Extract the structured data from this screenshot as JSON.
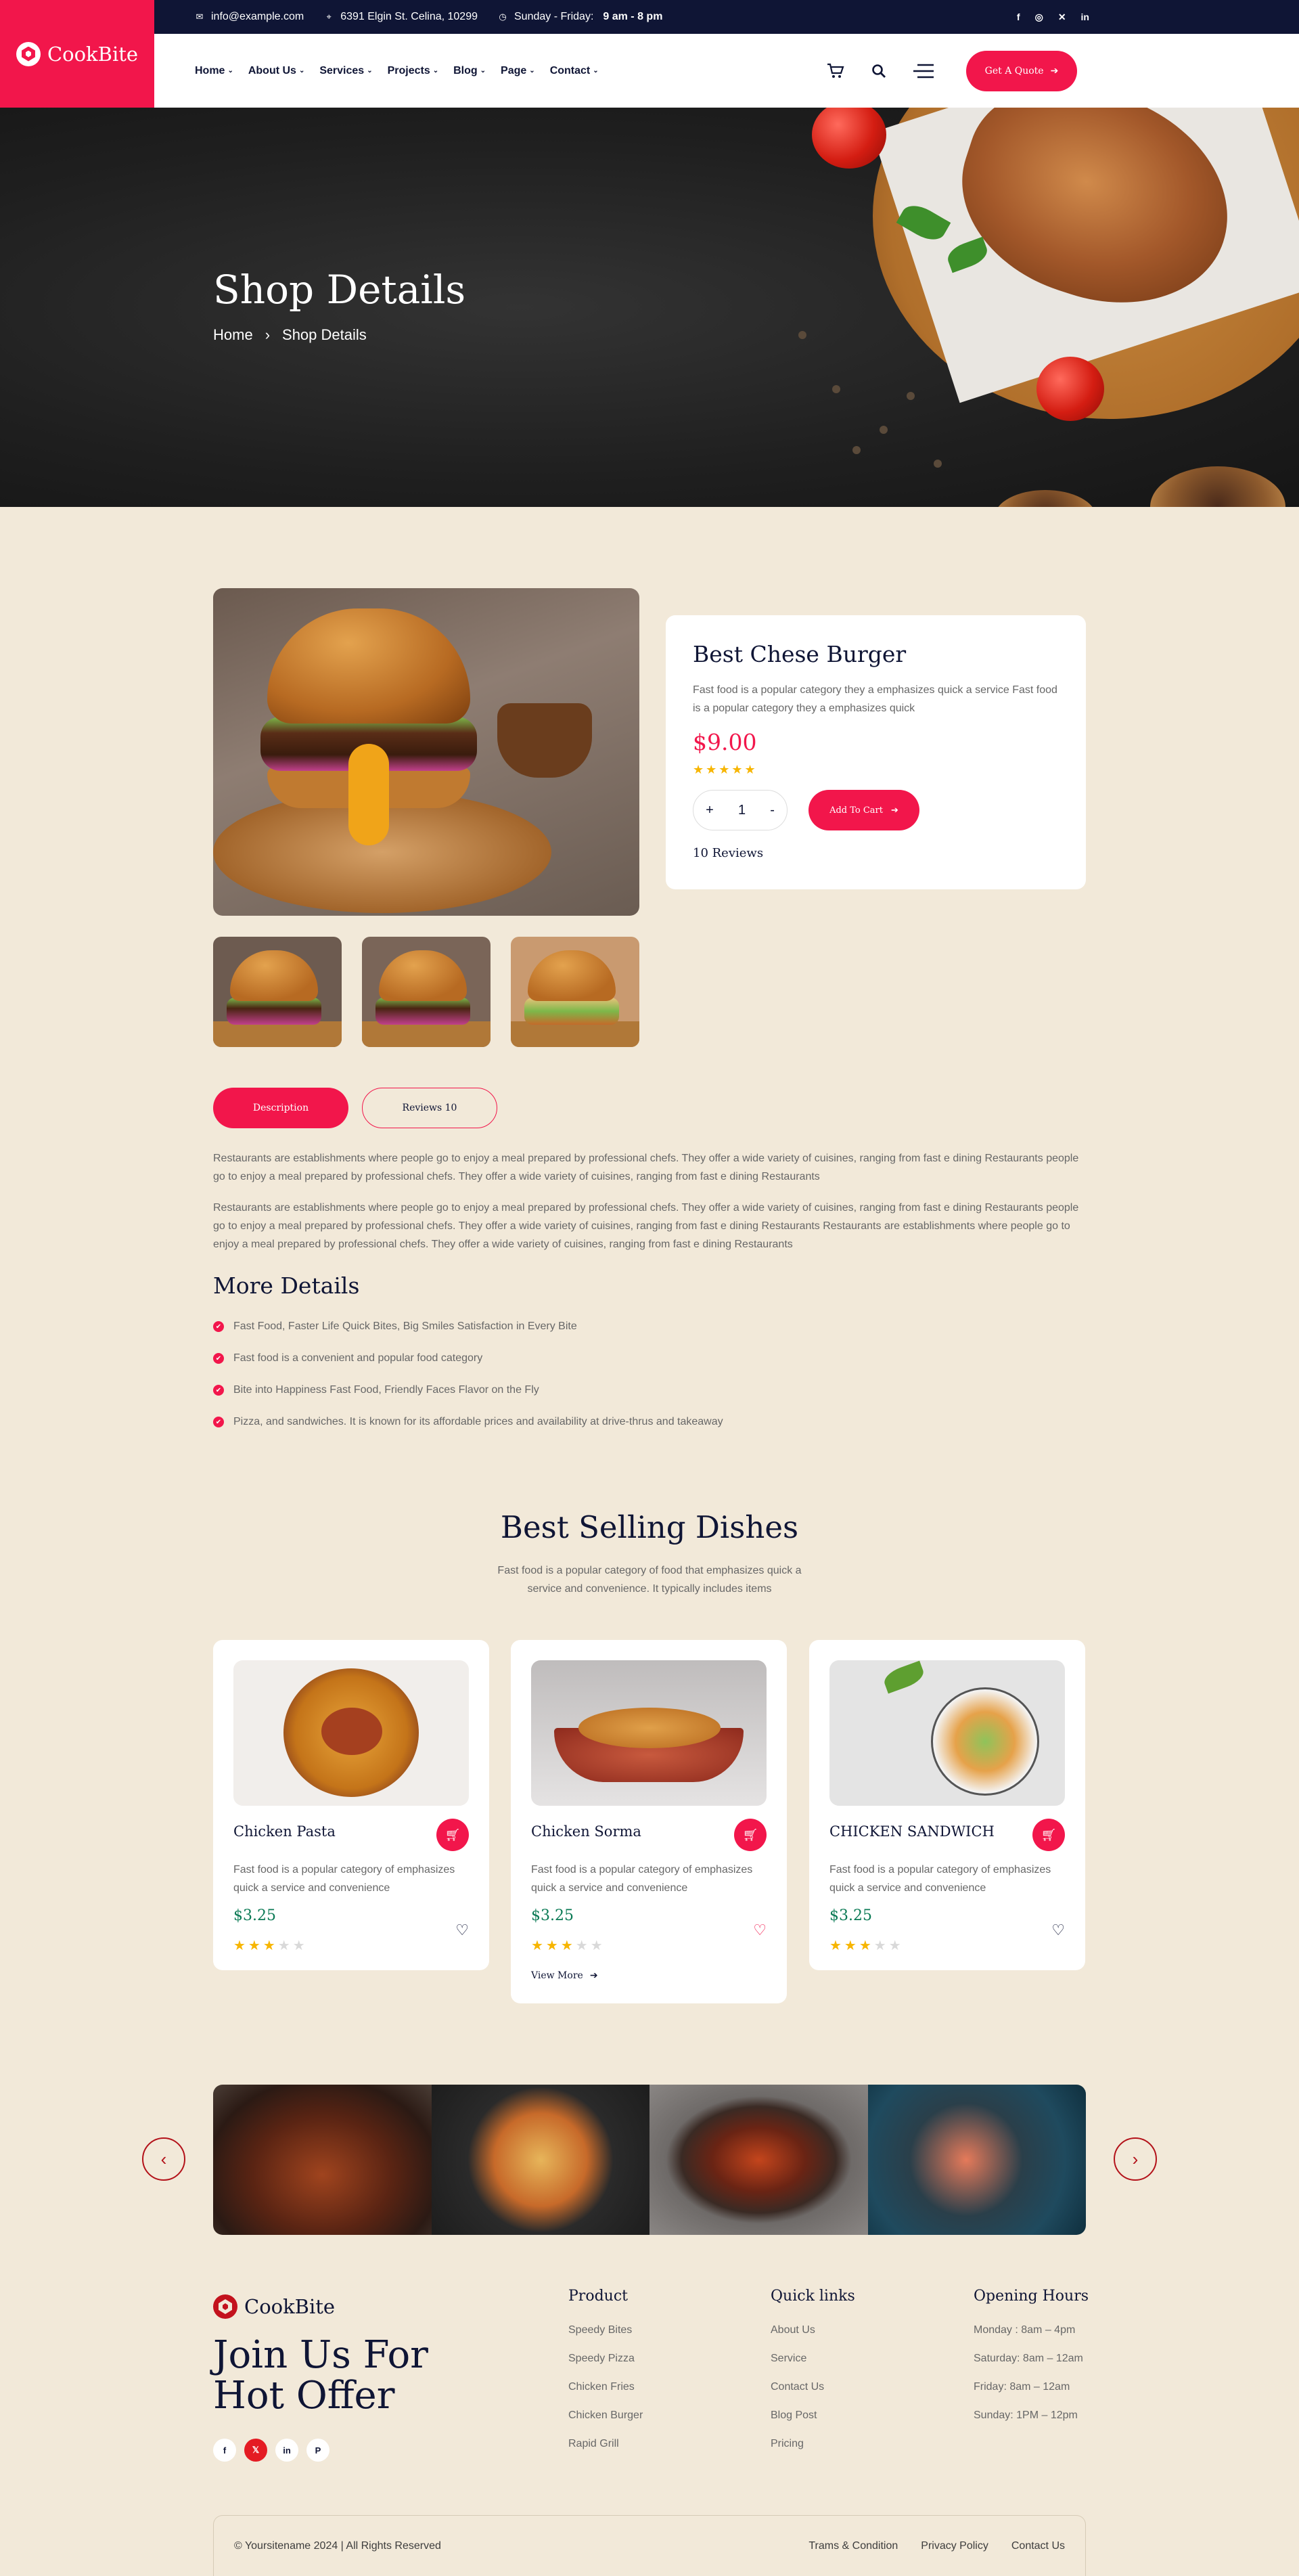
{
  "brand": {
    "name": "CookBite"
  },
  "topbar": {
    "email": "info@example.com",
    "address": "6391 Elgin St. Celina, 10299",
    "hours_label": "Sunday - Friday:",
    "hours_value": "9 am - 8 pm",
    "socials": [
      "facebook-icon",
      "instagram-icon",
      "twitter-icon",
      "linkedin-icon"
    ]
  },
  "nav": {
    "items": [
      "Home",
      "About Us",
      "Services",
      "Projects",
      "Blog",
      "Page",
      "Contact"
    ],
    "quote_label": "Get A Quote"
  },
  "hero": {
    "title": "Shop Details",
    "breadcrumb": [
      "Home",
      "Shop Details"
    ]
  },
  "product": {
    "name": "Best Chese Burger",
    "description": "Fast food is a popular category they a emphasizes quick a service Fast food is a popular category they a emphasizes quick",
    "price": "$9.00",
    "rating": 5,
    "quantity": "1",
    "add_to_cart": "Add To Cart",
    "reviews": "10 Reviews"
  },
  "tabs": {
    "description": "Description",
    "reviews": "Reviews 10"
  },
  "description": {
    "p1": "Restaurants are establishments where people go to enjoy a meal prepared by professional chefs. They offer a wide variety of cuisines, ranging from fast e dining Restaurants people go to enjoy a meal prepared by professional chefs. They offer a wide variety of cuisines, ranging from fast e dining Restaurants",
    "p2": "Restaurants are establishments where people go to enjoy a meal prepared by professional chefs. They offer a wide variety of cuisines, ranging from fast e dining Restaurants people go to enjoy a meal prepared by professional chefs. They offer a wide variety of cuisines, ranging from fast e dining Restaurants Restaurants are establishments where people go to enjoy a meal prepared by professional chefs. They offer a wide variety of cuisines, ranging from fast e dining Restaurants"
  },
  "more_details": {
    "title": "More Details",
    "items": [
      "Fast Food, Faster Life Quick Bites, Big Smiles Satisfaction in Every Bite",
      "Fast food is a convenient and popular food category",
      "Bite into Happiness Fast Food, Friendly Faces Flavor on the Fly",
      "Pizza, and sandwiches. It is known for its affordable prices and availability at drive-thrus and takeaway"
    ]
  },
  "best_selling": {
    "title": "Best Selling Dishes",
    "subtitle": "Fast food is a popular category of food that emphasizes quick a service and convenience. It typically includes items",
    "dishes": [
      {
        "name": "Chicken Pasta",
        "desc": "Fast food is a popular category of emphasizes quick a service and convenience",
        "price": "$3.25",
        "rating": 3
      },
      {
        "name": "Chicken Sorma",
        "desc": "Fast food is a popular category of emphasizes quick a service and convenience",
        "price": "$3.25",
        "rating": 3,
        "view_more": "View More"
      },
      {
        "name": "CHICKEN SANDWICH",
        "desc": "Fast food is a popular category of emphasizes quick a service and convenience",
        "price": "$3.25",
        "rating": 3
      }
    ]
  },
  "footer": {
    "join": "Join Us For Hot Offer",
    "socials": [
      "facebook-icon",
      "x-icon",
      "linkedin-icon",
      "pinterest-icon"
    ],
    "product": {
      "title": "Product",
      "items": [
        "Speedy Bites",
        "Speedy Pizza",
        "Chicken Fries",
        "Chicken Burger",
        "Rapid Grill"
      ]
    },
    "quick_links": {
      "title": "Quick links",
      "items": [
        "About Us",
        "Service",
        "Contact Us",
        "Blog Post",
        "Pricing"
      ]
    },
    "opening_hours": {
      "title": "Opening Hours",
      "items": [
        "Monday : 8am – 4pm",
        "Saturday: 8am – 12am",
        "Friday: 8am – 12am",
        "Sunday: 1PM – 12pm"
      ]
    },
    "copyright": "© Yoursitename  2024 | All Rights Reserved",
    "bottom_links": [
      "Trams & Condition",
      "Privacy Policy",
      "Contact Us"
    ]
  },
  "colors": {
    "accent": "#f2164b",
    "navy": "#0f1535",
    "cream": "#f2e9d9",
    "price_green": "#0b7a55"
  }
}
